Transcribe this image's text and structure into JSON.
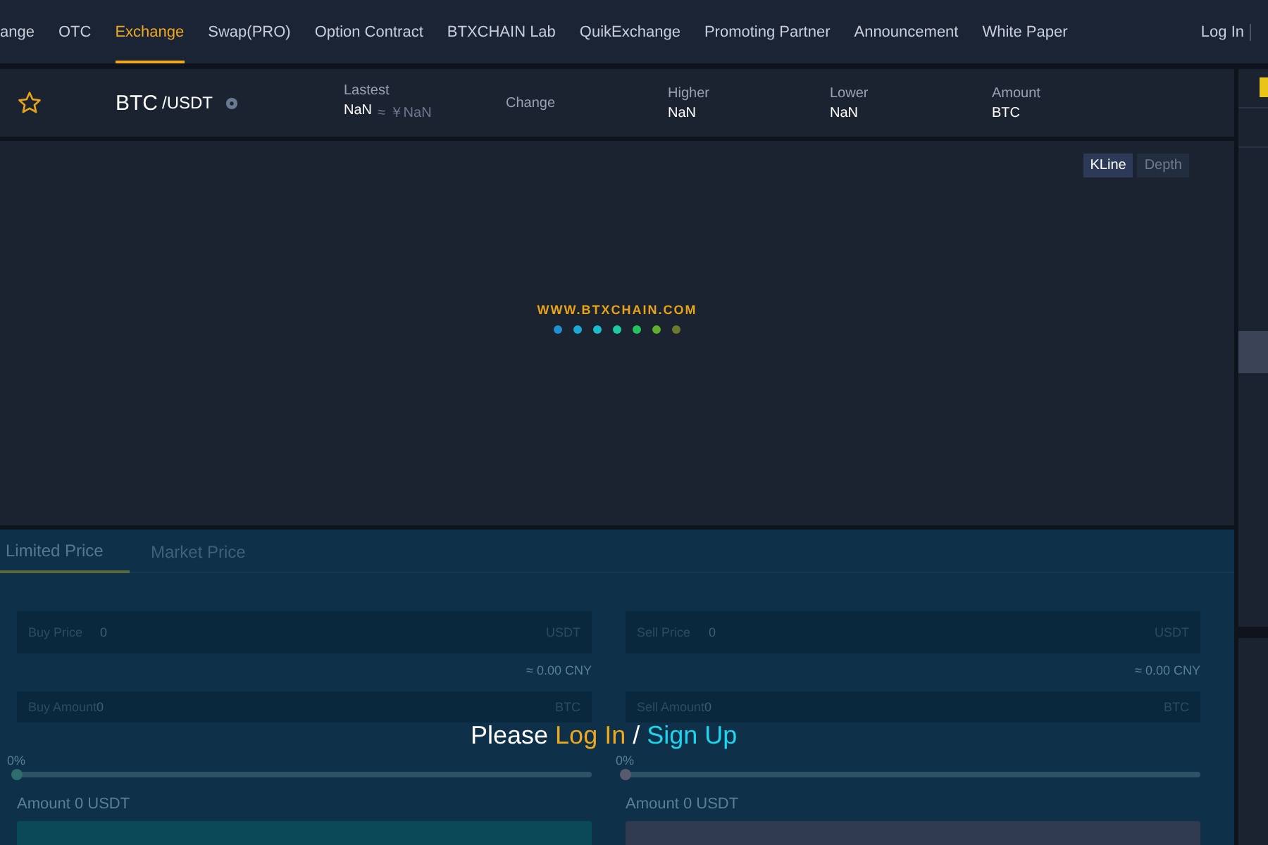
{
  "nav": {
    "items": [
      {
        "label": "ange",
        "selected": false
      },
      {
        "label": "OTC",
        "selected": false
      },
      {
        "label": "Exchange",
        "selected": true
      },
      {
        "label": "Swap(PRO)",
        "selected": false
      },
      {
        "label": "Option Contract",
        "selected": false
      },
      {
        "label": "BTXCHAIN Lab",
        "selected": false
      },
      {
        "label": "QuikExchange",
        "selected": false
      },
      {
        "label": "Promoting Partner",
        "selected": false
      },
      {
        "label": "Announcement",
        "selected": false
      },
      {
        "label": "White Paper",
        "selected": false
      }
    ],
    "login": "Log In"
  },
  "ticker": {
    "pair": "BTC",
    "quote": "/USDT",
    "stats": [
      {
        "label": "Lastest",
        "value": "NaN",
        "extra": "≈ ￥NaN"
      },
      {
        "label": "Change"
      },
      {
        "label": "Higher",
        "value": "NaN"
      },
      {
        "label": "Lower",
        "value": "NaN"
      },
      {
        "label": "Amount",
        "value": "BTC"
      }
    ]
  },
  "chart": {
    "tabs": [
      {
        "label": "KLine",
        "selected": true
      },
      {
        "label": "Depth",
        "selected": false
      }
    ],
    "loading": {
      "text": "WWW.BTXCHAIN.COM",
      "dots": [
        {
          "color": "#1e8fd0"
        },
        {
          "color": "#1aa8d8"
        },
        {
          "color": "#19bcc8"
        },
        {
          "color": "#1cc9a0"
        },
        {
          "color": "#22c35c"
        },
        {
          "color": "#5fae2c"
        },
        {
          "color": "#6c7a2e"
        }
      ]
    }
  },
  "trade": {
    "tabs": [
      {
        "label": "Limited Price",
        "selected": true
      },
      {
        "label": "Market Price",
        "selected": false
      }
    ],
    "forms": [
      {
        "kind": "buy",
        "price_label": "Buy Price",
        "price_value": "0",
        "price_unit": "USDT",
        "approx": "≈ 0.00 CNY",
        "amount_label": "Buy Amount",
        "amount_value": "0",
        "amount_unit": "BTC",
        "percent": "0%",
        "level": 0,
        "total": "Amount 0 USDT"
      },
      {
        "kind": "sell",
        "price_label": "Sell Price",
        "price_value": "0",
        "price_unit": "USDT",
        "approx": "≈ 0.00 CNY",
        "amount_label": "Sell Amount",
        "amount_value": "0",
        "amount_unit": "BTC",
        "percent": "0%",
        "level": 0,
        "total": "Amount 0 USDT"
      }
    ]
  },
  "login_prompt": {
    "prefix": "Please",
    "login": "Log In",
    "separator": "/",
    "signup": "Sign Up"
  }
}
